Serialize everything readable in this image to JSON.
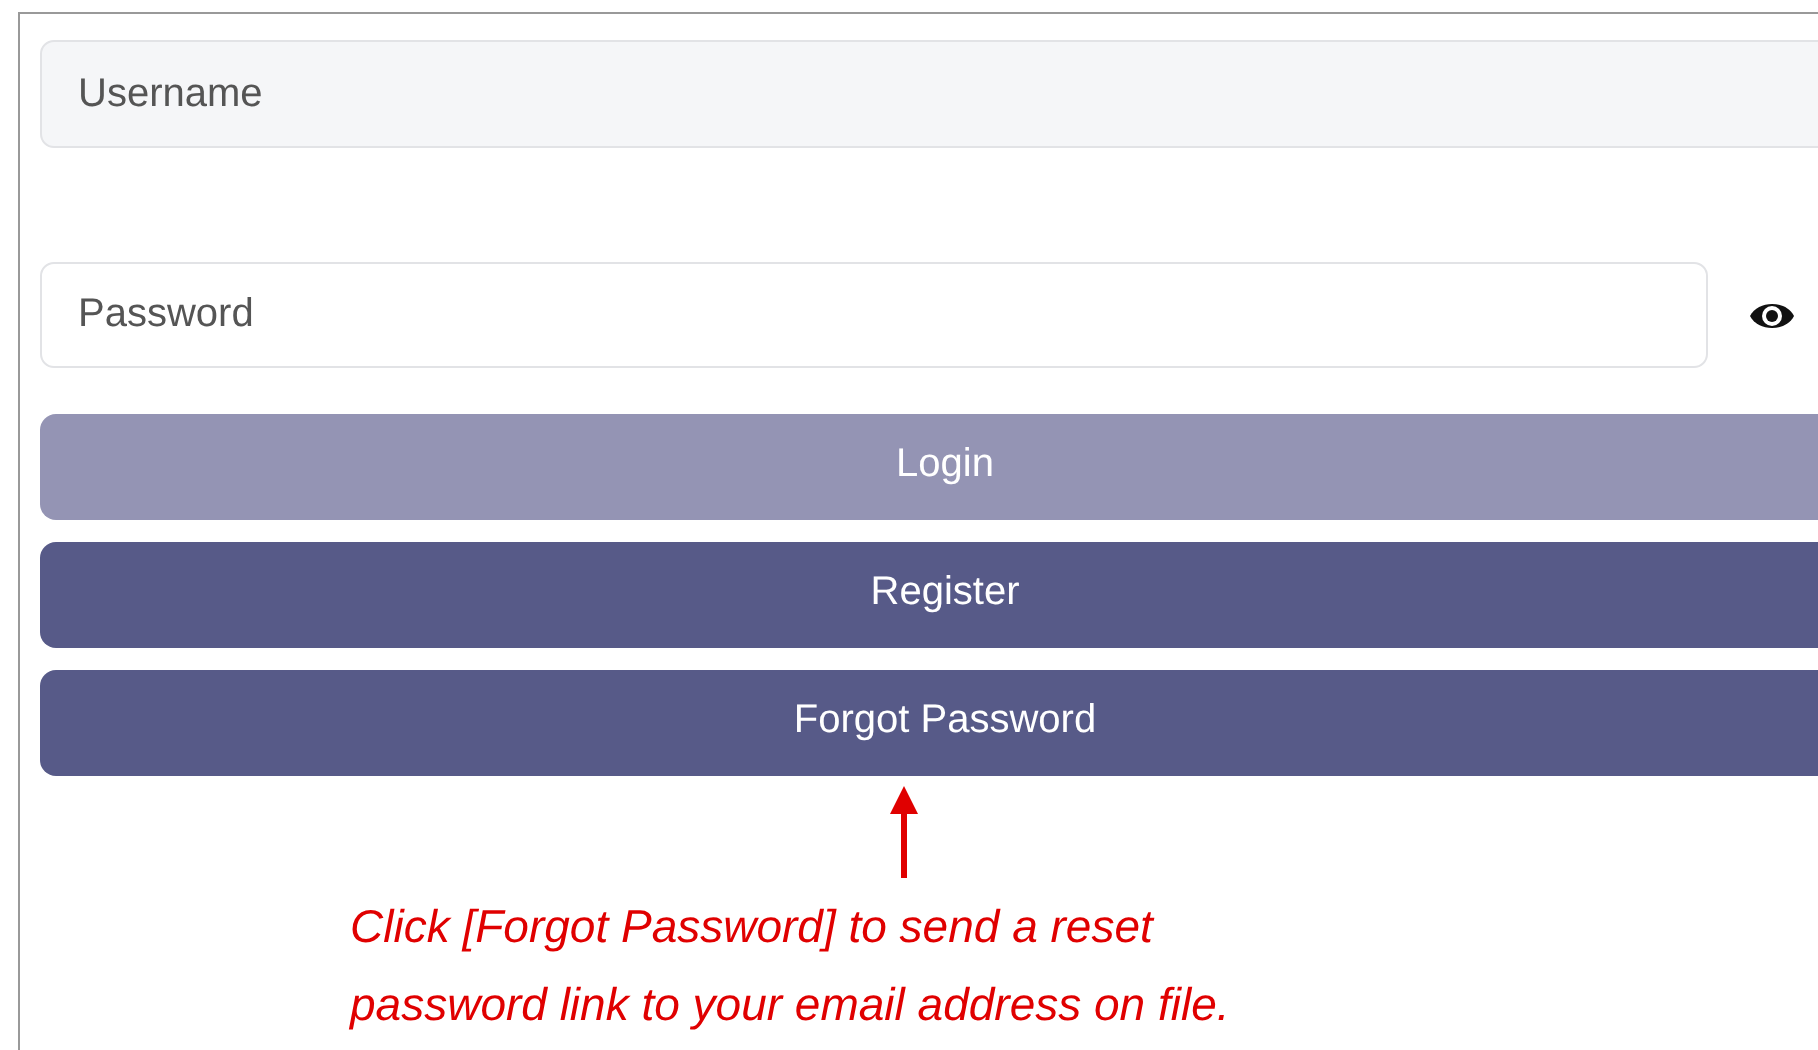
{
  "username": {
    "placeholder": "Username"
  },
  "password": {
    "placeholder": "Password"
  },
  "buttons": [
    {
      "label": "Login",
      "disabled": true
    },
    {
      "label": "Register",
      "disabled": false
    },
    {
      "label": "Forgot Password",
      "disabled": false
    }
  ],
  "annotation": {
    "text": "Click [Forgot Password] to send a reset password link to your email address on file."
  }
}
